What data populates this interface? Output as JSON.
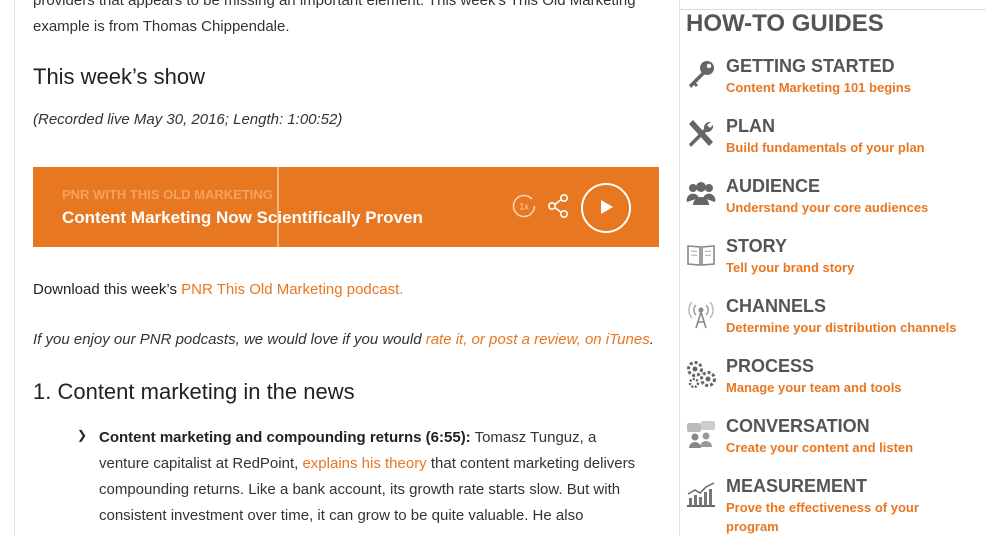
{
  "article": {
    "intro_text": "providers that appears to be missing an important element. This week's This Old Marketing example is from Thomas Chippendale.",
    "show_heading": "This week’s show",
    "recorded": "(Recorded live May 30, 2016; Length: 1:00:52)",
    "player": {
      "show_name": "PNR WITH THIS OLD MARKETING",
      "episode_title": "Content Marketing Now Scientifically Proven",
      "speed_label": "1x",
      "progress_fraction": 0.39
    },
    "download_prefix": "Download this week’s ",
    "download_link": "PNR This Old Marketing podcast.",
    "enjoy_prefix": "If you enjoy our PNR podcasts, we would love if you would ",
    "enjoy_link": "rate it, or post a review, on iTunes",
    "enjoy_suffix": ".",
    "news_heading": "1. Content marketing in the news",
    "bullet": {
      "bold": "Content marketing and compounding returns (6:55):",
      "text1": " Tomasz Tunguz, a venture capitalist at RedPoint, ",
      "link": "explains his theory",
      "text2": " that content marketing delivers compounding returns. Like a bank account, its growth rate starts slow. But with consistent investment over time, it can grow to be quite valuable. He also"
    }
  },
  "sidebar": {
    "title": "HOW-TO GUIDES",
    "guides": [
      {
        "title": "GETTING STARTED",
        "subtitle": "Content Marketing 101 begins",
        "icon": "key-icon"
      },
      {
        "title": "PLAN",
        "subtitle": "Build fundamentals of your plan",
        "icon": "tools-icon"
      },
      {
        "title": "AUDIENCE",
        "subtitle": "Understand your core audiences",
        "icon": "people-icon"
      },
      {
        "title": "STORY",
        "subtitle": "Tell your brand story",
        "icon": "book-icon"
      },
      {
        "title": "CHANNELS",
        "subtitle": "Determine your distribution channels",
        "icon": "broadcast-icon"
      },
      {
        "title": "PROCESS",
        "subtitle": "Manage your team and tools",
        "icon": "gears-icon"
      },
      {
        "title": "CONVERSATION",
        "subtitle": "Create your content and listen",
        "icon": "chat-icon"
      },
      {
        "title": "MEASUREMENT",
        "subtitle": "Prove the effectiveness of your program",
        "icon": "chart-icon"
      }
    ]
  },
  "colors": {
    "accent": "#e87722",
    "heading_gray": "#555555"
  }
}
